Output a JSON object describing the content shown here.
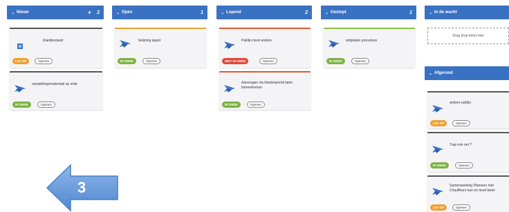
{
  "columns": {
    "nieuw": {
      "label": "Nieuw",
      "plus": "+",
      "count": "2"
    },
    "open": {
      "label": "Open",
      "count": "1"
    },
    "lopend": {
      "label": "Lopend",
      "count": "2"
    },
    "gestopt": {
      "label": "Gestopt",
      "count": "1"
    },
    "in_de_wacht": {
      "label": "In de wacht"
    },
    "afgerond": {
      "label": "Afgerond"
    }
  },
  "cards": {
    "klantbestand": {
      "title": "Klantbestand",
      "badge": "LET OP",
      "open": "Openen"
    },
    "verpakking": {
      "title": "verpakkingsmateriaal op orde",
      "badge": "IN ORDE",
      "open": "Openen"
    },
    "belijning": {
      "title": "belijning kapot",
      "badge": "IN ORDE",
      "open": "Openen"
    },
    "pakklijn": {
      "title": "Paklijn moet anders",
      "badge": "NIET IN ORDE",
      "open": "Openen"
    },
    "aanvragen": {
      "title": "Aanvragen via klantenportal laten binnenkomen",
      "badge": "IN ORDE",
      "open": "Openen"
    },
    "slotplaten": {
      "title": "slotplaten procedure",
      "badge": "IN ORDE",
      "open": "Openen"
    },
    "andere_paklijn": {
      "title": "andere paklijn",
      "badge": "LET OP",
      "open": "Openen"
    },
    "trap": {
      "title": "Trap ook net ?",
      "badge": "IN ORDE",
      "open": "Openen"
    },
    "samenwerking": {
      "title": "Samenwerking Planners met Chauffeurs kan en moet beter",
      "badge": "LET OP",
      "open": "Openen"
    }
  },
  "dropzone_text": "Drag drop items hier",
  "overlay_number": "3",
  "colors": {
    "header": "#3a72c3",
    "arrow": "#5b8fd6",
    "let_op": "#f0a030",
    "in_orde": "#7cb342",
    "niet_in_orde": "#e04a3a"
  }
}
